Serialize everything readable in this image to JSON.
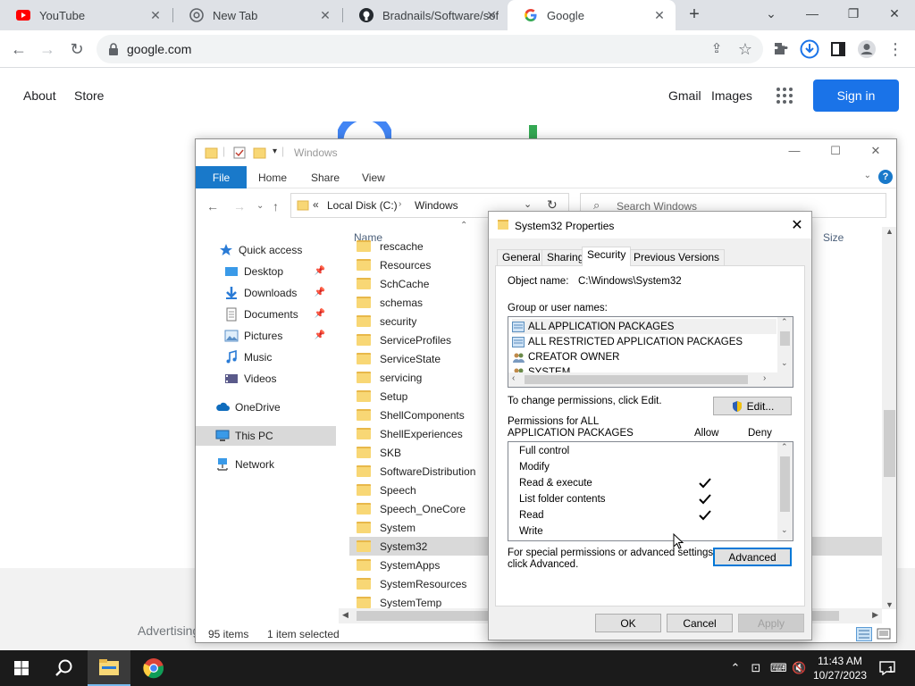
{
  "browser": {
    "tabs": [
      {
        "title": "YouTube",
        "icon": "youtube-icon"
      },
      {
        "title": "New Tab",
        "icon": "chrome-icon"
      },
      {
        "title": "Bradnails/Software/sof",
        "icon": "github-icon"
      },
      {
        "title": "Google",
        "icon": "google-icon",
        "active": true
      }
    ],
    "url": "google.com"
  },
  "google": {
    "about": "About",
    "store": "Store",
    "gmail": "Gmail",
    "images": "Images",
    "sign_in": "Sign in",
    "advertising": "Advertising"
  },
  "explorer": {
    "title": "Windows",
    "ribbon": {
      "file": "File",
      "home": "Home",
      "share": "Share",
      "view": "View"
    },
    "address": {
      "root": "Local Disk (C:)",
      "folder": "Windows"
    },
    "search_placeholder": "Search Windows",
    "nav": [
      {
        "label": "Quick access",
        "icon": "star-icon"
      },
      {
        "label": "Desktop",
        "icon": "desktop-icon",
        "pinned": true
      },
      {
        "label": "Downloads",
        "icon": "download-icon",
        "pinned": true
      },
      {
        "label": "Documents",
        "icon": "document-icon",
        "pinned": true
      },
      {
        "label": "Pictures",
        "icon": "picture-icon",
        "pinned": true
      },
      {
        "label": "Music",
        "icon": "music-icon"
      },
      {
        "label": "Videos",
        "icon": "video-icon"
      },
      {
        "label": "OneDrive",
        "icon": "cloud-icon"
      },
      {
        "label": "This PC",
        "icon": "computer-icon",
        "selected": true
      },
      {
        "label": "Network",
        "icon": "network-icon"
      }
    ],
    "columns": {
      "name": "Name",
      "size": "Size"
    },
    "files": [
      "rescache",
      "Resources",
      "SchCache",
      "schemas",
      "security",
      "ServiceProfiles",
      "ServiceState",
      "servicing",
      "Setup",
      "ShellComponents",
      "ShellExperiences",
      "SKB",
      "SoftwareDistribution",
      "Speech",
      "Speech_OneCore",
      "System",
      "System32",
      "SystemApps",
      "SystemResources",
      "SystemTemp"
    ],
    "selected_file": "System32",
    "status": {
      "items": "95 items",
      "selected": "1 item selected"
    }
  },
  "dialog": {
    "title": "System32 Properties",
    "tabs": [
      "General",
      "Sharing",
      "Security",
      "Previous Versions"
    ],
    "active_tab": "Security",
    "object_label": "Object name:",
    "object_value": "C:\\Windows\\System32",
    "group_label": "Group or user names:",
    "groups": [
      "ALL APPLICATION PACKAGES",
      "ALL RESTRICTED APPLICATION PACKAGES",
      "CREATOR OWNER",
      "SYSTEM"
    ],
    "change_text": "To change permissions, click Edit.",
    "edit_button": "Edit...",
    "perm_for_line1": "Permissions for ALL",
    "perm_for_line2": "APPLICATION PACKAGES",
    "allow": "Allow",
    "deny": "Deny",
    "permissions": [
      {
        "name": "Full control",
        "allow": false
      },
      {
        "name": "Modify",
        "allow": false
      },
      {
        "name": "Read & execute",
        "allow": true
      },
      {
        "name": "List folder contents",
        "allow": true
      },
      {
        "name": "Read",
        "allow": true
      },
      {
        "name": "Write",
        "allow": false
      }
    ],
    "special_line1": "For special permissions or advanced settings,",
    "special_line2": "click Advanced.",
    "advanced_button": "Advanced",
    "ok": "OK",
    "cancel": "Cancel",
    "apply": "Apply"
  },
  "taskbar": {
    "time": "11:43 AM",
    "date": "10/27/2023",
    "notifications": "1"
  },
  "colors": {
    "google_blue": "#1a73e8",
    "explorer_blue": "#1979ca",
    "taskbar": "#1b1b1b"
  }
}
